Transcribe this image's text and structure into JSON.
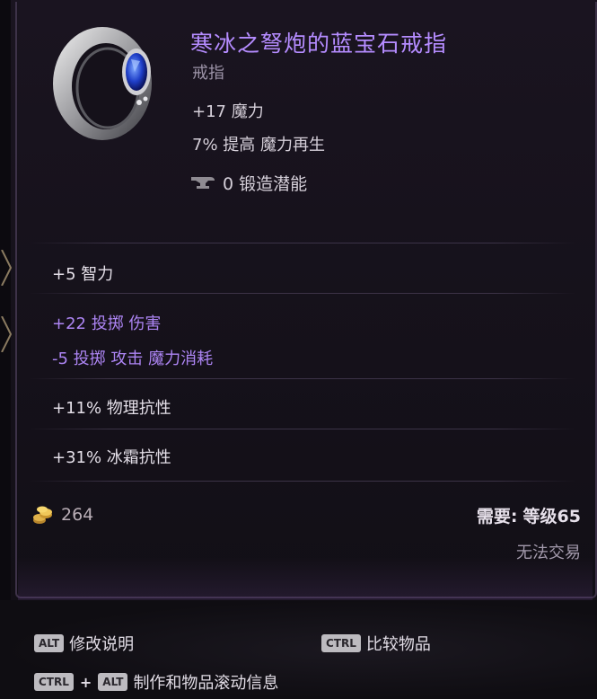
{
  "item": {
    "name": "寒冰之弩炮的蓝宝石戒指",
    "type": "戒指",
    "base_stats": [
      "+17 魔力",
      "7% 提高 魔力再生"
    ],
    "forge_potential": "0 锻造潜能",
    "icon": "sapphire-ring"
  },
  "affixes": {
    "intelligence": "+5 智力",
    "throw_damage": "+22 投掷 伤害",
    "throw_mana_cost": "-5 投掷 攻击 魔力消耗",
    "physical_res": "+11% 物理抗性",
    "cold_res": "+31% 冰霜抗性"
  },
  "footer_info": {
    "gold": "264",
    "requirement_label": "需要:",
    "requirement_value": "等级65",
    "tradeable": "无法交易"
  },
  "hints": {
    "alt_key": "ALT",
    "alt_action": "修改说明",
    "ctrl_key": "CTRL",
    "ctrl_action": "比较物品",
    "combo_plus": "+",
    "combo_action": "制作和物品滚动信息"
  },
  "colors": {
    "title": "#b58cff",
    "affix_purple": "#ad85f4",
    "panel_bg": "#15111a"
  }
}
